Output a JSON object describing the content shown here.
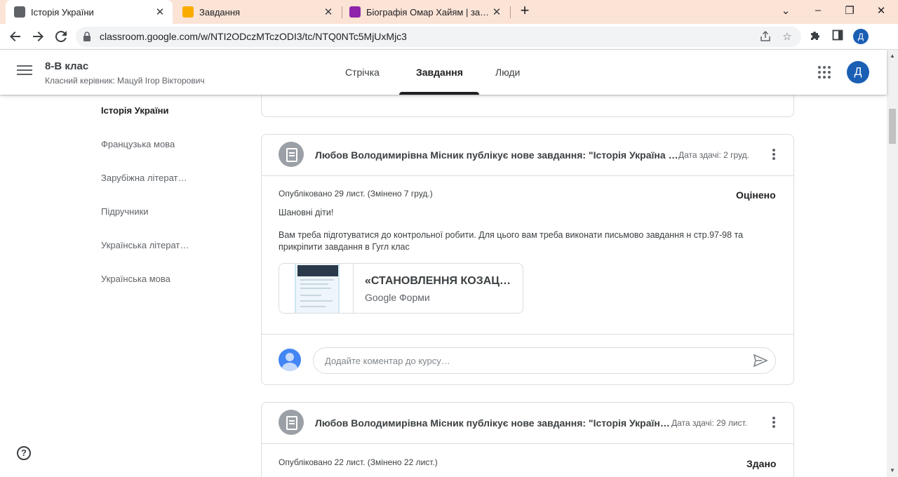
{
  "browser": {
    "tabs": [
      {
        "label": "Історія України",
        "active": true,
        "favicon_color": "#5f6368"
      },
      {
        "label": "Завдання",
        "active": false,
        "favicon_color": "#f9ab00"
      },
      {
        "label": "Біографія Омар Хайям | зарубіж",
        "active": false,
        "favicon_color": "#8e24aa"
      }
    ],
    "close_glyph": "✕",
    "url": "classroom.google.com/w/NTI2ODczMTczODI3/tc/NTQ0NTc5MjUxMjc3",
    "profile_letter": "Д"
  },
  "header": {
    "class_title": "8-В клас",
    "class_subtitle": "Класний керівник: Мацуй Ігор Вікторович",
    "tabs": [
      "Стрічка",
      "Завдання",
      "Люди"
    ],
    "active_tab": "Завдання",
    "avatar_letter": "Д"
  },
  "sidebar": {
    "items": [
      "Історія України",
      "Французька мова",
      "Зарубіжна література",
      "Підручники",
      "Українська література",
      "Українська мова"
    ],
    "active": "Історія України"
  },
  "cards": [
    {
      "title": "Любов Володимирівна Місник публікує нове завдання: \"Історія Україна Підсумкова контрольна робота\"",
      "due": "Дата здачі: 2 груд.",
      "posted": "Опубліковано 29 лист. (Змінено 7 груд.)",
      "status": "Оцінено",
      "greeting": "Шановні діти!",
      "body": " Вам треба підготуватися до контрольної робити. Для цього вам треба виконати  письмово завдання н стр.97-98 та прикріпити завдання в Гугл клас",
      "attachment": {
        "title": "«СТАНОВЛЕННЯ КОЗАЦТВА»",
        "type": "Google Форми"
      },
      "comment_placeholder": "Додайте коментар до курсу…"
    },
    {
      "title": "Любов Володимирівна Місник публікує нове завдання: \"Історія України Козацтво\"",
      "due": "Дата здачі: 29 лист.",
      "posted": "Опубліковано 22 лист. (Змінено 22 лист.)",
      "status": "Здано"
    }
  ],
  "icons": {
    "back": "arrow-left-icon",
    "forward": "arrow-right-icon",
    "reload": "reload-icon",
    "lock": "lock-icon",
    "share": "share-icon",
    "star": "star-icon",
    "extensions": "puzzle-icon",
    "sidepanel": "sidepanel-icon",
    "menu": "hamburger-icon",
    "apps": "apps-grid-icon",
    "assignment": "assignment-icon",
    "send": "send-icon",
    "help": "help-icon"
  },
  "colors": {
    "tabstrip": "#fbe3d6",
    "accent_avatar": "#1a5fb4",
    "comment_avatar": "#4285f4"
  }
}
